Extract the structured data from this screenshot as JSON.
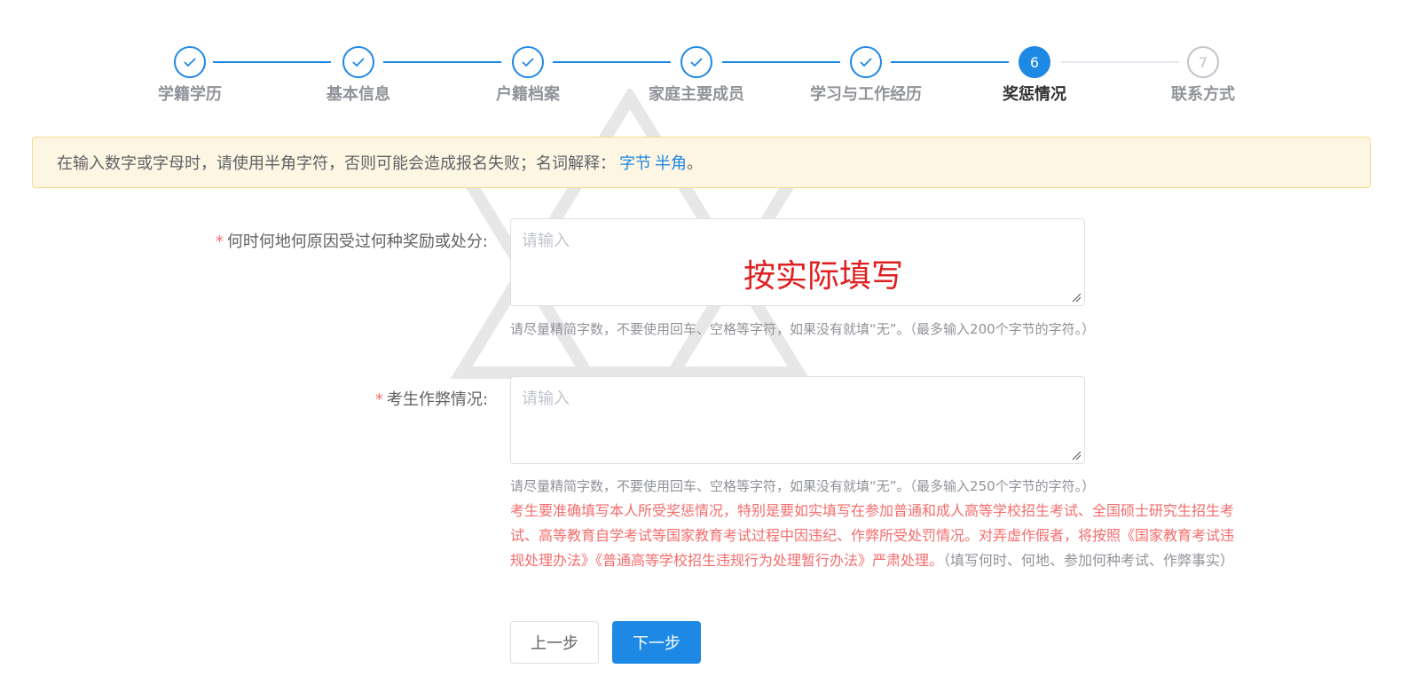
{
  "steps": [
    {
      "label": "学籍学历",
      "status": "done",
      "icon": "check-icon"
    },
    {
      "label": "基本信息",
      "status": "done",
      "icon": "check-icon"
    },
    {
      "label": "户籍档案",
      "status": "done",
      "icon": "check-icon"
    },
    {
      "label": "家庭主要成员",
      "status": "done",
      "icon": "check-icon"
    },
    {
      "label": "学习与工作经历",
      "status": "done",
      "icon": "check-icon"
    },
    {
      "label": "奖惩情况",
      "status": "active",
      "number": "6"
    },
    {
      "label": "联系方式",
      "status": "pending",
      "number": "7"
    }
  ],
  "alert": {
    "text": "在输入数字或字母时，请使用半角字符，否则可能会造成报名失败；名词解释：",
    "link1": "字节",
    "link2": "半角",
    "tail": "。"
  },
  "form": {
    "required_mark": "*",
    "field1": {
      "label": "何时何地何原因受过何种奖励或处分:",
      "placeholder": "请输入",
      "hint": "请尽量精简字数，不要使用回车、空格等字符，如果没有就填“无”。（最多输入200个字节的字符。）"
    },
    "field2": {
      "label": "考生作弊情况:",
      "placeholder": "请输入",
      "hint": "请尽量精简字数，不要使用回车、空格等字符，如果没有就填“无”。（最多输入250个字节的字符。）",
      "warning": "考生要准确填写本人所受奖惩情况，特别是要如实填写在参加普通和成人高等学校招生考试、全国硕士研究生招生考试、高等教育自学考试等国家教育考试过程中因违纪、作弊所受处罚情况。对弄虚作假者，将按照《国家教育考试违规处理办法》《普通高等学校招生违规行为处理暂行办法》严肃处理。",
      "warning_tail": "（填写何时、何地、参加何种考试、作弊事实）"
    }
  },
  "overlay": {
    "text": "按实际填写"
  },
  "buttons": {
    "prev": "上一步",
    "next": "下一步"
  },
  "colors": {
    "primary": "#1e88e5",
    "danger": "#f56c6c",
    "overlay": "#e02020"
  }
}
